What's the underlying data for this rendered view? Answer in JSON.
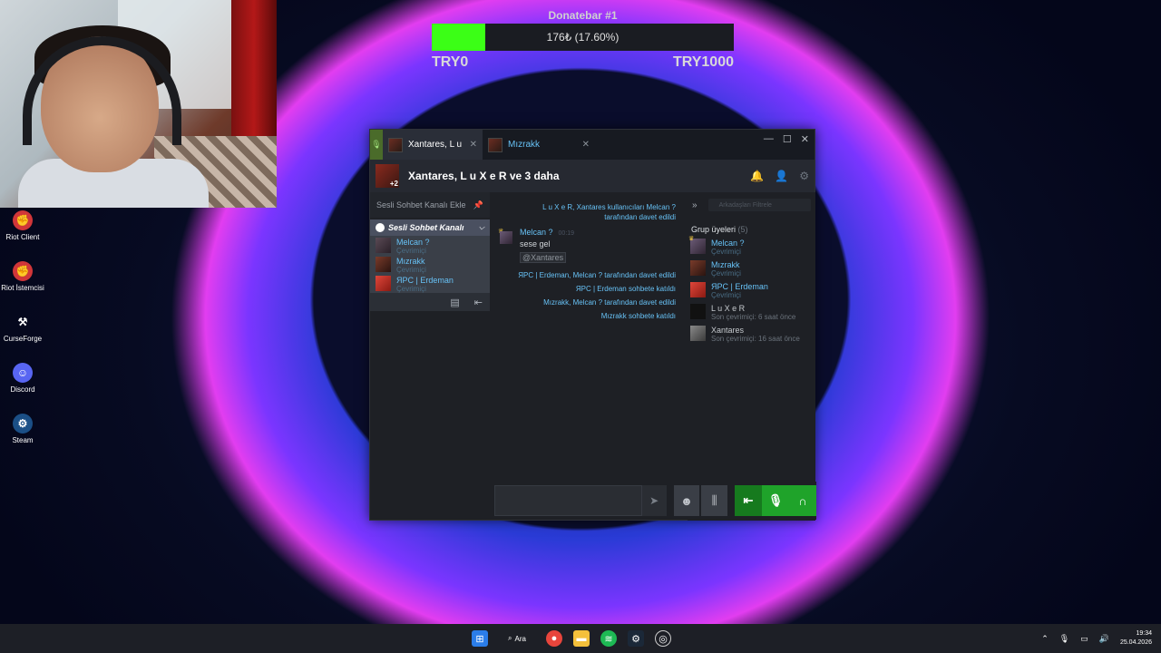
{
  "donatebar": {
    "title": "Donatebar #1",
    "progress_label": "176₺ (17.60%)",
    "progress_fraction": 0.176,
    "min_label": "TRY0",
    "max_label": "TRY1000"
  },
  "desktop_icons": [
    {
      "label": "Riot Client",
      "icon": "riot-icon"
    },
    {
      "label": "Riot İstemcisi",
      "icon": "riot-icon"
    },
    {
      "label": "CurseForge",
      "icon": "curseforge-icon"
    },
    {
      "label": "Discord",
      "icon": "discord-icon"
    },
    {
      "label": "Steam",
      "icon": "steam-icon"
    }
  ],
  "chat_window": {
    "tabs": [
      {
        "label": "Xantares, L u"
      },
      {
        "label": "Mızrakk"
      }
    ],
    "group_name": "Xantares, L u X e R ve 3 daha",
    "group_badge": "+2",
    "add_voice_label": "Sesli Sohbet Kanalı Ekle",
    "voice_channel": {
      "name": "Sesli Sohbet Kanalı",
      "members": [
        {
          "name": "Melcan ?",
          "status": "Çevrimiçi"
        },
        {
          "name": "Mızrakk",
          "status": "Çevrimiçi"
        },
        {
          "name": "ЯPC | Erdeman",
          "status": "Çevrimiçi"
        }
      ]
    },
    "messages": {
      "sys1": "L u X e R, Xantares kullanıcıları Melcan ? tarafından davet edildi",
      "author": "Melcan ?",
      "author_time": "00:19",
      "line1": "sese gel",
      "mention": "@Xantares",
      "sys2": "ЯPC | Erdeman, Melcan ? tarafından davet edildi",
      "sys3": "ЯPC | Erdeman sohbete katıldı",
      "sys4": "Mızrakk, Melcan ? tarafından davet edildi",
      "sys5": "Mızrakk sohbete katıldı"
    },
    "members_panel": {
      "filter_placeholder": "Arkadaşları Filtrele",
      "group_title": "Grup üyeleri",
      "group_count": "(5)",
      "members": [
        {
          "name": "Melcan ?",
          "status": "Çevrimiçi"
        },
        {
          "name": "Mızrakk",
          "status": "Çevrimiçi"
        },
        {
          "name": "ЯPC | Erdeman",
          "status": "Çevrimiçi"
        },
        {
          "name": "L u X e R",
          "status": "Son çevrimiçi: 6 saat önce"
        },
        {
          "name": "Xantares",
          "status": "Son çevrimiçi: 16 saat önce"
        }
      ]
    }
  },
  "taskbar": {
    "search_label": "Ara",
    "time": "19:34",
    "date": "25.04.2026"
  }
}
